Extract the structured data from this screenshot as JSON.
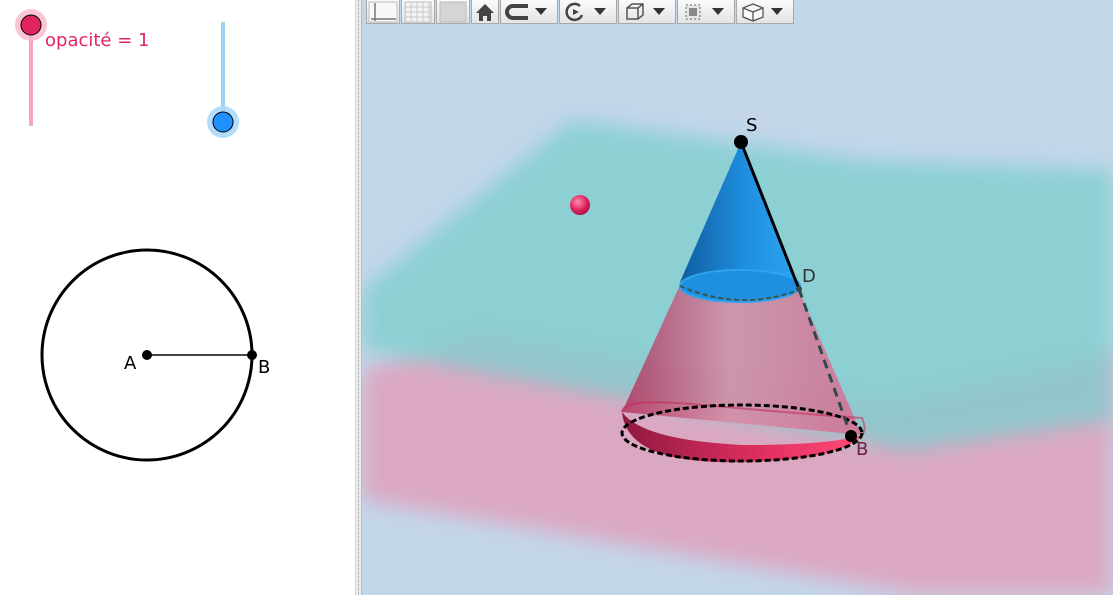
{
  "algebra_view": {
    "slider_opacity": {
      "caption": "opacité = 1",
      "value": 1,
      "color": "#e0245e"
    },
    "slider_height": {
      "value": 0,
      "color": "#1e90ff"
    },
    "circle": {
      "center_label": "A",
      "point_label": "B"
    }
  },
  "graphics3d": {
    "apex_label": "S",
    "cut_point_label": "D",
    "base_point_label": "B",
    "colors": {
      "background": "#c3d6ea",
      "plane_top": "#7fcfcf",
      "plane_bottom": "#e0a0bc",
      "cone_top": "#1f8fe0",
      "cone_bottom": "#e8305f"
    }
  },
  "toolbar": {
    "buttons": [
      {
        "name": "axes-toggle-icon"
      },
      {
        "name": "grid-toggle-icon"
      },
      {
        "name": "plane-toggle-icon"
      },
      {
        "name": "home-icon"
      },
      {
        "name": "magnet-icon"
      },
      {
        "name": "rotate-view-icon"
      },
      {
        "name": "clipping-cube-icon"
      },
      {
        "name": "selection-box-icon"
      },
      {
        "name": "projection-cube-icon"
      }
    ]
  }
}
